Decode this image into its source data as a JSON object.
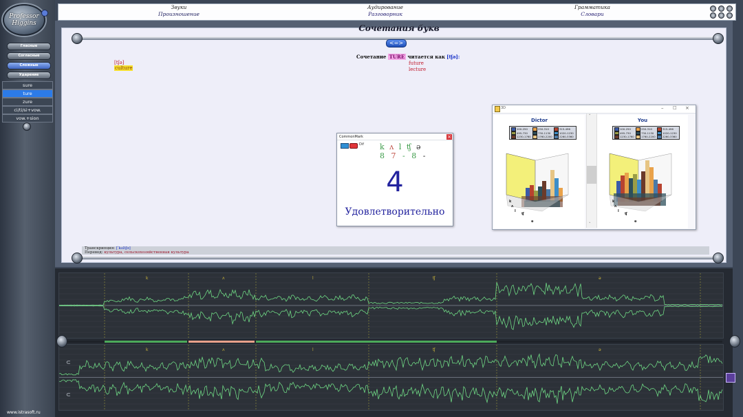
{
  "app": {
    "logo_text": "Professor Higgins",
    "site": "www.istrasoft.ru"
  },
  "topmenu": [
    {
      "line1": "Звуки",
      "line2": "Произношение"
    },
    {
      "line1": "Аудирование",
      "line2": "Разговорник"
    },
    {
      "line1": "Грамматика",
      "line2": "Словари"
    }
  ],
  "sidebar": {
    "sections": [
      "Гласные",
      "Согласные",
      "Сложные",
      "Ударение"
    ],
    "active_section": "Сложные",
    "subitems": [
      "sure",
      "ture",
      "zure",
      "ci/ti/si+vow.",
      "vow.+sion"
    ],
    "active_subitem": "ture"
  },
  "page": {
    "title": "Сочетания букв",
    "nav_button": "<=>",
    "caption_prefix": "Сочетание",
    "caption_highlight": "TURE",
    "caption_mid": "читается как",
    "caption_transcription": "[tʃə]:",
    "left_transcription": "[tʃə]",
    "left_word": "culture",
    "right_words": [
      "future",
      "lecture"
    ],
    "transcription_label": "Транскрипция:",
    "transcription_value": "[ˈkʌltʃə]",
    "translation_label": "Перевод:",
    "translation_value": "культура, сельскохозяйственная культура"
  },
  "common_mark": {
    "window_title": "CommonMark",
    "toolbar_label": "Dif",
    "phonemes": [
      "k",
      "ʌ",
      "l",
      "ʧ",
      "ə"
    ],
    "scores": [
      "8",
      "7",
      "-",
      "8",
      "-"
    ],
    "score": "4",
    "verdict": "Удовлетворительно"
  },
  "graph3d": {
    "window_title": "3D",
    "dictor_title": "Dictor",
    "you_title": "You",
    "legend": [
      {
        "label": "100-250",
        "color": "#3b5aa8"
      },
      {
        "label": "250-310",
        "color": "#e9a24a"
      },
      {
        "label": "315-496",
        "color": "#b8432f"
      },
      {
        "label": "495-730",
        "color": "#9a9d46"
      },
      {
        "label": "730-1130",
        "color": "#2d4f5b"
      },
      {
        "label": "1020-1230",
        "color": "#3d8ec8"
      },
      {
        "label": "1230-1760",
        "color": "#6b3a2a"
      },
      {
        "label": "1760-2200",
        "color": "#e7c584"
      },
      {
        "label": "2260-3360",
        "color": "#4c7aa8"
      }
    ],
    "axis_phonemes": [
      "k",
      "ʌ",
      "l",
      "ʧ",
      "ə"
    ]
  },
  "waveform": {
    "phoneme_labels": [
      "k",
      "ʌ",
      "l",
      "ʧ",
      "ə"
    ]
  }
}
